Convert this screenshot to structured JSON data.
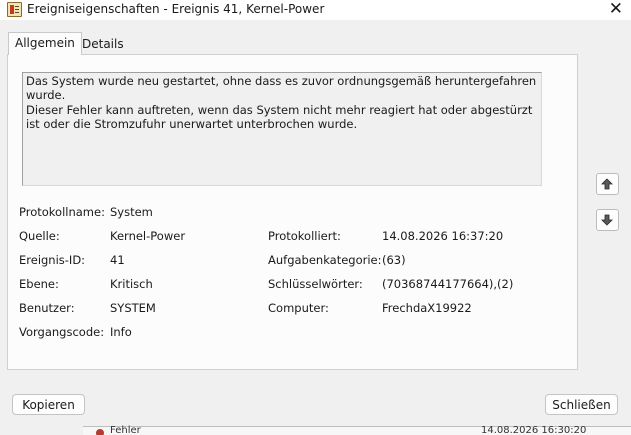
{
  "window": {
    "title": "Ereigniseigenschaften - Ereignis 41, Kernel-Power",
    "close_glyph": "✕"
  },
  "tabs": [
    {
      "label": "Allgemein",
      "active": true
    },
    {
      "label": "Details",
      "active": false
    }
  ],
  "description": [
    "Das System wurde neu gestartet, ohne dass es zuvor ordnungsgemäß heruntergefahren wurde.",
    "Dieser Fehler kann auftreten, wenn das System nicht mehr reagiert hat oder abgestürzt ist oder die Stromzufuhr unerwartet unterbrochen wurde."
  ],
  "fields": {
    "protokollname": {
      "label": "Protokollname:",
      "value": "System"
    },
    "quelle": {
      "label": "Quelle:",
      "value": "Kernel-Power"
    },
    "ereignis_id": {
      "label": "Ereignis-ID:",
      "value": "41"
    },
    "ebene": {
      "label": "Ebene:",
      "value": "Kritisch"
    },
    "benutzer": {
      "label": "Benutzer:",
      "value": "SYSTEM"
    },
    "vorgangscode": {
      "label": "Vorgangscode:",
      "value": "Info"
    },
    "protokolliert": {
      "label": "Protokolliert:",
      "value": "14.08.2026 16:37:20"
    },
    "aufgabenkategorie": {
      "label": "Aufgabenkategorie:",
      "value": "(63)"
    },
    "schluesselwoerter": {
      "label": "Schlüsselwörter:",
      "value": "(70368744177664),(2)"
    },
    "computer": {
      "label": "Computer:",
      "value": "FrechdaX19922"
    }
  },
  "nav": {
    "up_icon": "arrow-up-icon",
    "down_icon": "arrow-down-icon"
  },
  "buttons": {
    "copy": "Kopieren",
    "close": "Schließen"
  },
  "background_row": {
    "level": "Fehler",
    "timestamp": "14.08.2026 16:30:20"
  },
  "colors": {
    "window_bg": "#f0f0f0",
    "panel_bg": "#fcfcfc",
    "error_red": "#b83a2a"
  }
}
